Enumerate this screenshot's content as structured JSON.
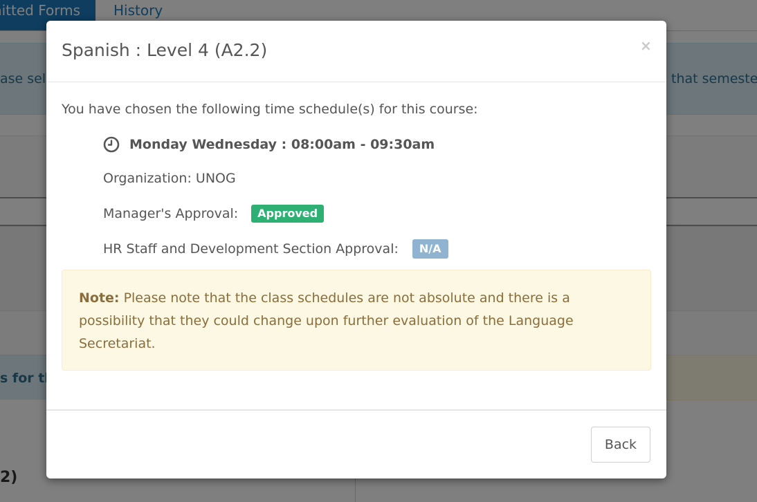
{
  "background": {
    "tabs": [
      {
        "label": "nitted Forms"
      },
      {
        "label": "History"
      }
    ],
    "info_left": "ase sel",
    "info_right": "that semeste",
    "band2_text": "s for the",
    "level_text": "2)"
  },
  "modal": {
    "title": "Spanish : Level 4 (A2.2)",
    "close_label": "×",
    "intro": "You have chosen the following time schedule(s) for this course:",
    "schedule": "Monday Wednesday : 08:00am - 09:30am",
    "organization": "Organization: UNOG",
    "manager_label": "Manager's Approval:",
    "manager_status": "Approved",
    "hr_label": "HR Staff and Development Section Approval:",
    "hr_status": "N/A",
    "note_label": "Note:",
    "note_text": " Please note that the class schedules are not absolute and there is a possibility that they could change upon further evaluation of the Language Secretariat.",
    "back_label": "Back"
  },
  "colors": {
    "approved": "#2eb074",
    "na": "#8fb3d0",
    "note_bg": "#fcf8e3",
    "note_text": "#8a6d3b"
  }
}
